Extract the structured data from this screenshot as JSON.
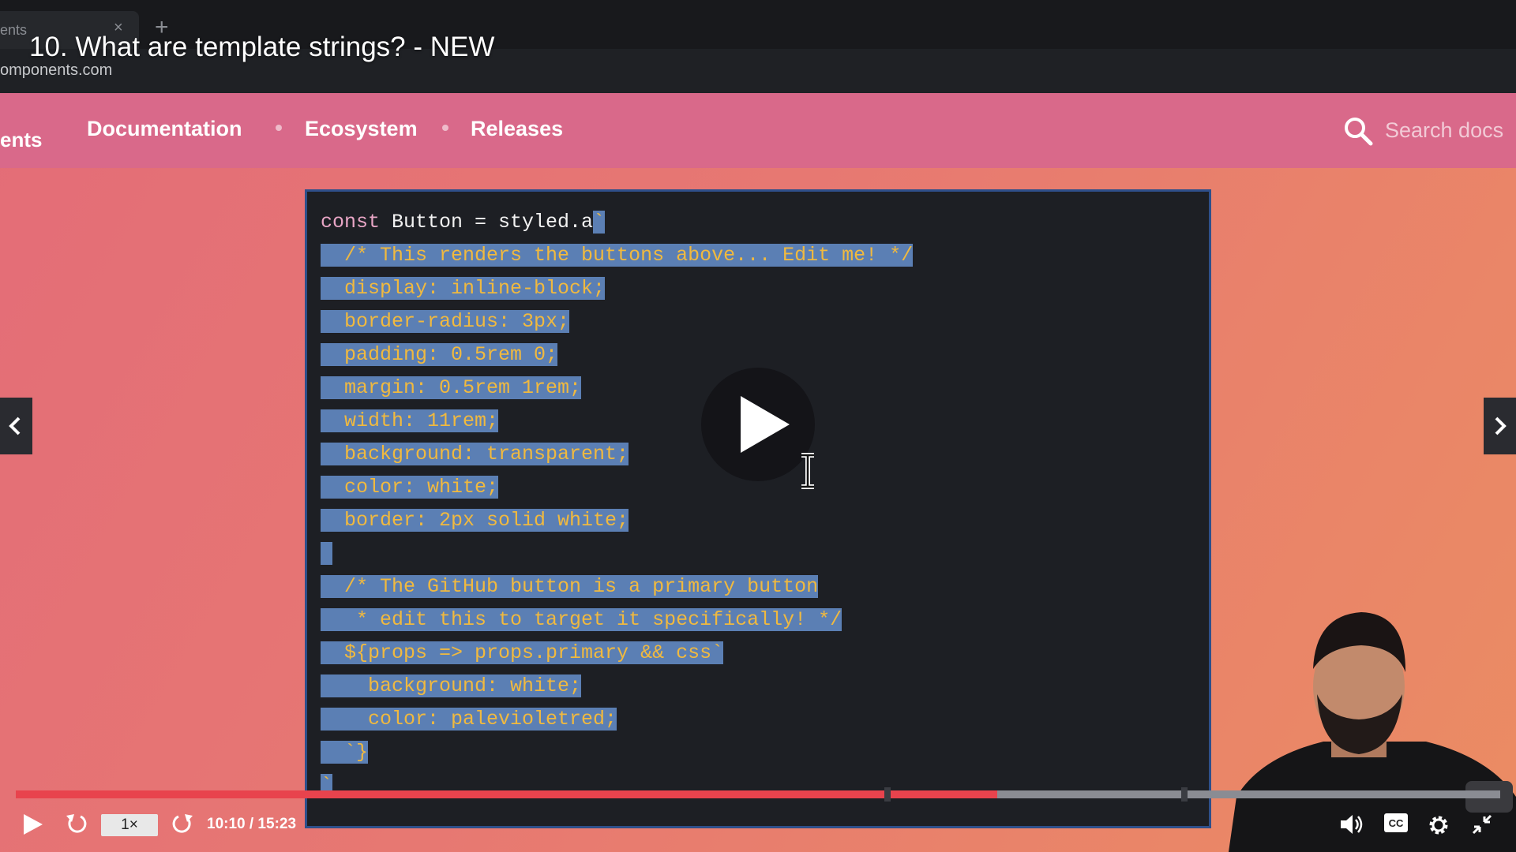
{
  "browser": {
    "tab_label": "ents",
    "tab_close": "×",
    "new_tab": "+",
    "url": "omponents.com"
  },
  "video": {
    "title": "10. What are template strings? - NEW"
  },
  "site_nav": {
    "cut_label": "ents",
    "links": [
      "Documentation",
      "Ecosystem",
      "Releases"
    ],
    "search_placeholder": "Search docs"
  },
  "code": {
    "first_line": {
      "kw": "const",
      "plain": " Button = styled.a",
      "tick": "`"
    },
    "lines": [
      "  /* This renders the buttons above... Edit me! */",
      "  display: inline-block;",
      "  border-radius: 3px;",
      "  padding: 0.5rem 0;",
      "  margin: 0.5rem 1rem;",
      "  width: 11rem;",
      "  background: transparent;",
      "  color: white;",
      "  border: 2px solid white;",
      " ",
      "  /* The GitHub button is a primary button",
      "   * edit this to target it specifically! */",
      "  ${props => props.primary && css`",
      "    background: white;",
      "    color: palevioletred;",
      "  `}",
      "`"
    ]
  },
  "player": {
    "speed": "1×",
    "time": "10:10 / 15:23",
    "progress_fraction": 0.661,
    "buffered_fraction": 1.0,
    "marker_fractions": [
      0.587,
      0.787
    ]
  },
  "icons": {
    "play": "play-icon",
    "replay": "rewind-icon",
    "forward": "forward-icon",
    "volume": "volume-icon",
    "captions": "captions-icon",
    "settings": "gear-icon",
    "exit_fullscreen": "exit-fullscreen-icon",
    "search": "search-icon"
  },
  "colors": {
    "progress": "#e8434d",
    "selection": "#5b7fb4",
    "code": "#f0b93f",
    "nav": "#d9698a"
  }
}
